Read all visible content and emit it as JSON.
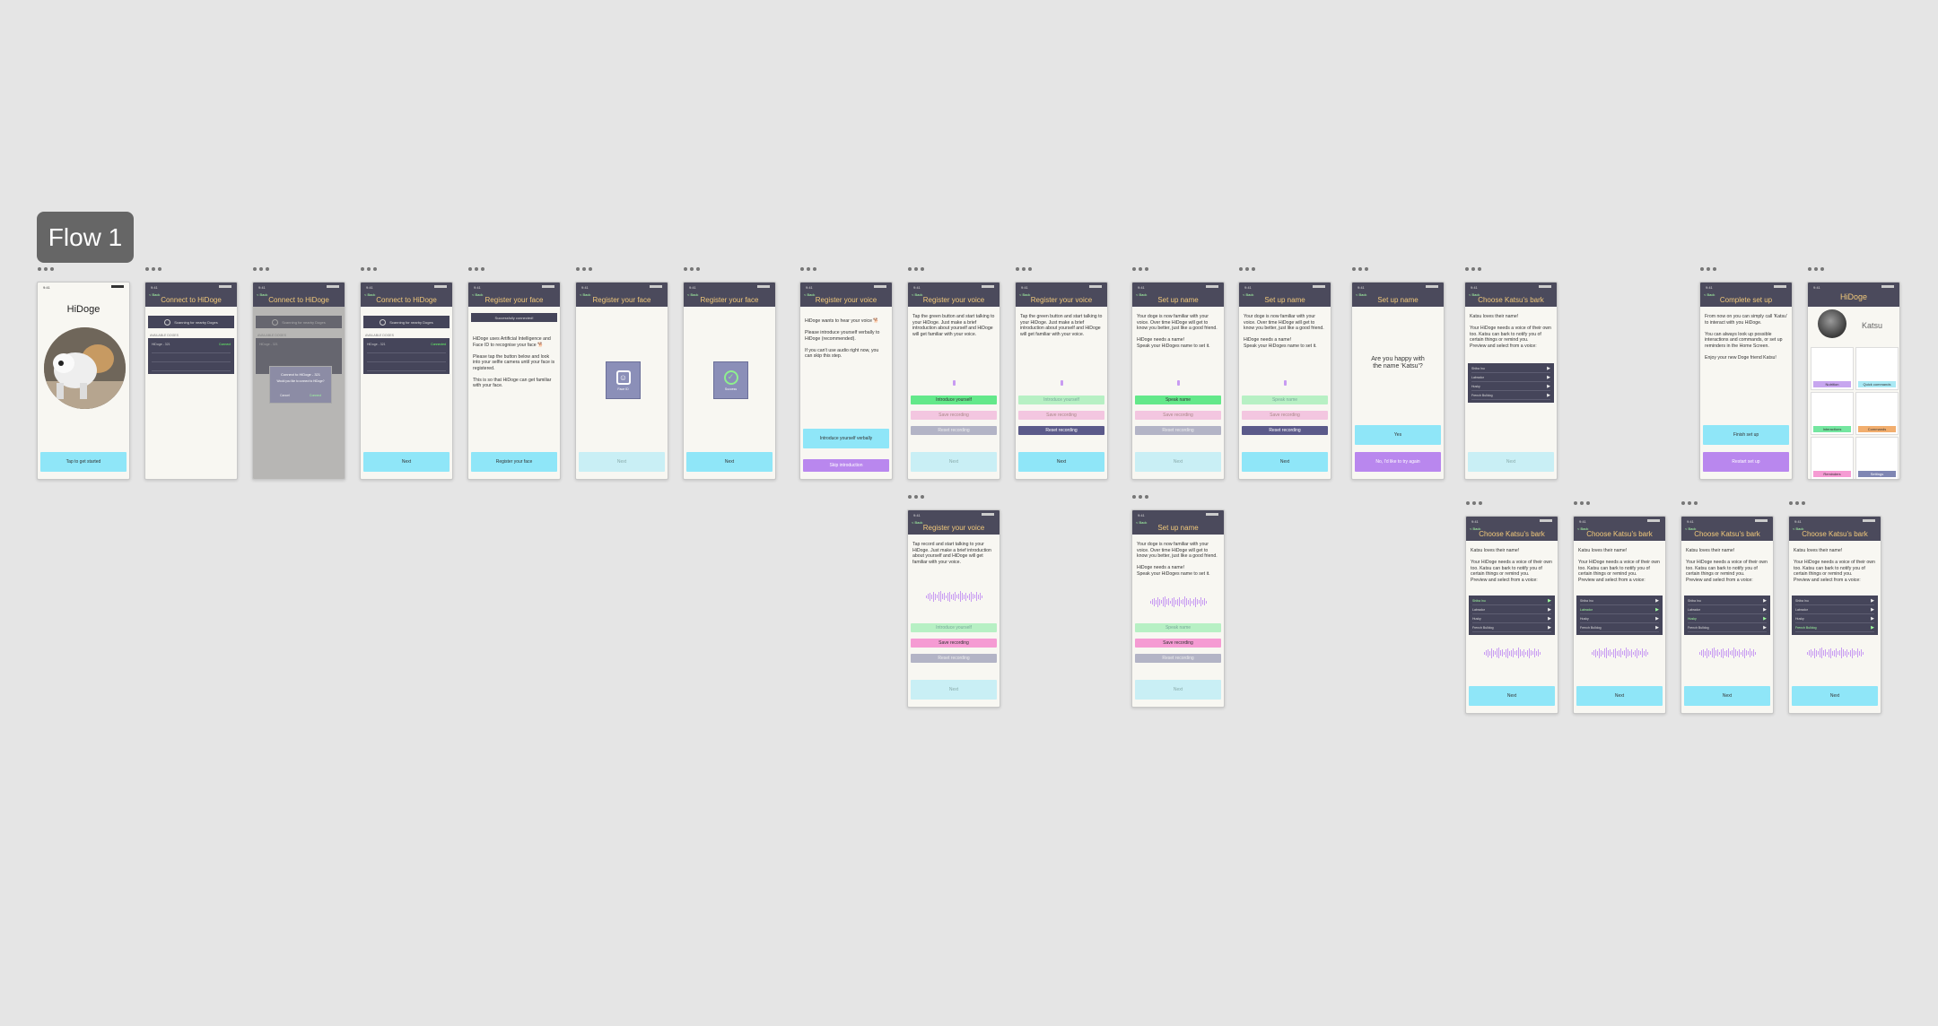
{
  "board": {
    "title": "Flow 1"
  },
  "status": {
    "time": "9:41",
    "back": "< Back"
  },
  "common": {
    "next": "Next",
    "title_connect": "Connect to HiDoge",
    "title_face": "Register your face",
    "title_voice": "Register your voice",
    "title_name": "Set up name",
    "title_bark": "Choose Katsu's bark",
    "title_complete": "Complete set up"
  },
  "welcome": {
    "title": "HiDoge",
    "cta": "Tap to get started"
  },
  "connect": {
    "scanning": "Scanning for nearby Doges",
    "available_label": "AVAILABLE DOGES",
    "device": "HiDoge - 321",
    "device_status": "Connect",
    "connected_status": "Connected",
    "modal_title": "Connect to HiDoge - 321",
    "modal_text": "Would you like to connect to HiDoge?",
    "modal_cancel": "Cancel",
    "modal_ok": "Connect"
  },
  "face": {
    "banner": "Successfully connected!",
    "intro": "HiDoge uses Artificial Intelligence and Face ID to recognise your face 🐕\n\nPlease tap the button below and look into your selfie camera until your face is registered.\n\nThis is so that HiDoge can get familiar with your face.",
    "cta": "Register your face",
    "tile_label": "Face ID",
    "success_label": "Success"
  },
  "voice": {
    "intro": "HiDoge wants to hear your voice 🐕\n\nPlease introduce yourself verbally to HiDoge (recommended).\n\nIf you can't use audio right now, you can skip this step.",
    "cta_intro": "Introduce yourself verbally",
    "cta_skip": "Skip introduction",
    "instructions": "Tap the green button and start talking to your HiDoge. Just make a brief introduction about yourself and HiDoge will get familiar with your voice.",
    "instructions_record": "Tap record and start talking to your HiDoge. Just make a brief introduction about yourself and HiDoge will get familiar with your voice.",
    "btn_introduce": "Introduce yourself",
    "btn_save": "Save recording",
    "btn_reset": "Reset recording"
  },
  "name": {
    "instructions": "Your doge is now familiar with your voice. Over time HiDoge will get to know you better, just like a good friend.\n\nHiDoge needs a name!\nSpeak your HiDoges name to set it.",
    "btn_speak": "Speak name",
    "btn_save": "Save recording",
    "btn_reset": "Reset recording",
    "confirm_question": "Are you happy with the name 'Katsu'?",
    "btn_yes": "Yes",
    "btn_retry": "No, I'd like to try again"
  },
  "bark": {
    "intro": "Katsu loves their name!\n\nYour HiDoge needs a voice of their own too. Katsu can bark to notify you of certain things or remind you.\nPreview and select from a voice:",
    "options": [
      "Shiba Inu",
      "Labrador",
      "Husky",
      "French Bulldog"
    ]
  },
  "complete": {
    "text": "From now on you can simply call 'Katsu' to interact with you HiDoge.\n\nYou can always look up possible interactions and commands, or set up reminders in the Home Screen.\n\nEnjoy your new Doge friend Katsu!",
    "btn_finish": "Finish set up",
    "btn_restart": "Restart set up"
  },
  "home": {
    "title": "HiDoge",
    "pet_name": "Katsu",
    "tiles": [
      "Nutrition",
      "Quick commands",
      "Interactions",
      "Commands",
      "Reminders",
      "Settings"
    ],
    "tile_colors": [
      "#c7a6ef",
      "#a9e9f5",
      "#74e6a0",
      "#f2ae6e",
      "#f59bd3",
      "#7f86b3"
    ]
  },
  "colors": {
    "header": "#4b4a5c",
    "accent_cyan": "#8fe6f8",
    "accent_purple": "#b987ee",
    "accent_green": "#63e88a",
    "accent_pink": "#f59bd3",
    "title_text": "#f2c97a"
  }
}
